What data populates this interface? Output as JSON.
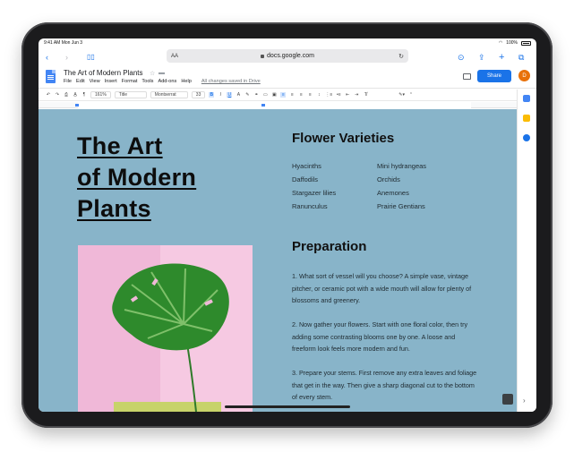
{
  "status_bar": {
    "time_date": "9:41 AM  Mon Jun 3",
    "battery": "100%"
  },
  "browser": {
    "aa_label": "AA",
    "url": "docs.google.com"
  },
  "doc": {
    "title": "The Art of Modern Plants",
    "menu": [
      "File",
      "Edit",
      "View",
      "Insert",
      "Format",
      "Tools",
      "Add-ons",
      "Help"
    ],
    "saved_status": "All changes saved in Drive",
    "share_label": "Share",
    "avatar_letter": "D"
  },
  "toolbar": {
    "zoom": "161%",
    "style": "Title",
    "font": "Montserrat",
    "font_size": "33",
    "bold": "B",
    "italic": "I",
    "underline": "U"
  },
  "content": {
    "title_lines": [
      "The Art",
      "of Modern",
      "Plants"
    ],
    "varieties_heading": "Flower Varieties",
    "varieties": [
      "Hyacinths",
      "Mini hydrangeas",
      "Daffodils",
      "Orchids",
      "Stargazer lilies",
      "Anemones",
      "Ranunculus",
      "Prairie Gentians"
    ],
    "prep_heading": "Preparation",
    "prep_paragraphs": [
      "1. What sort of vessel will you choose? A simple vase, vintage pitcher, or ceramic pot with a wide mouth will allow for plenty of blossoms and greenery.",
      "2. Now gather your flowers. Start with one floral color, then try adding some contrasting blooms one by one. A loose and freeform look feels more modern and fun.",
      "3. Prepare your stems. First remove any extra leaves and foliage that get in the way. Then give a sharp diagonal cut to the bottom of every stem."
    ]
  },
  "colors": {
    "page_bg": "#88b4c9",
    "accent": "#1a73e8",
    "avatar": "#e8710a"
  }
}
